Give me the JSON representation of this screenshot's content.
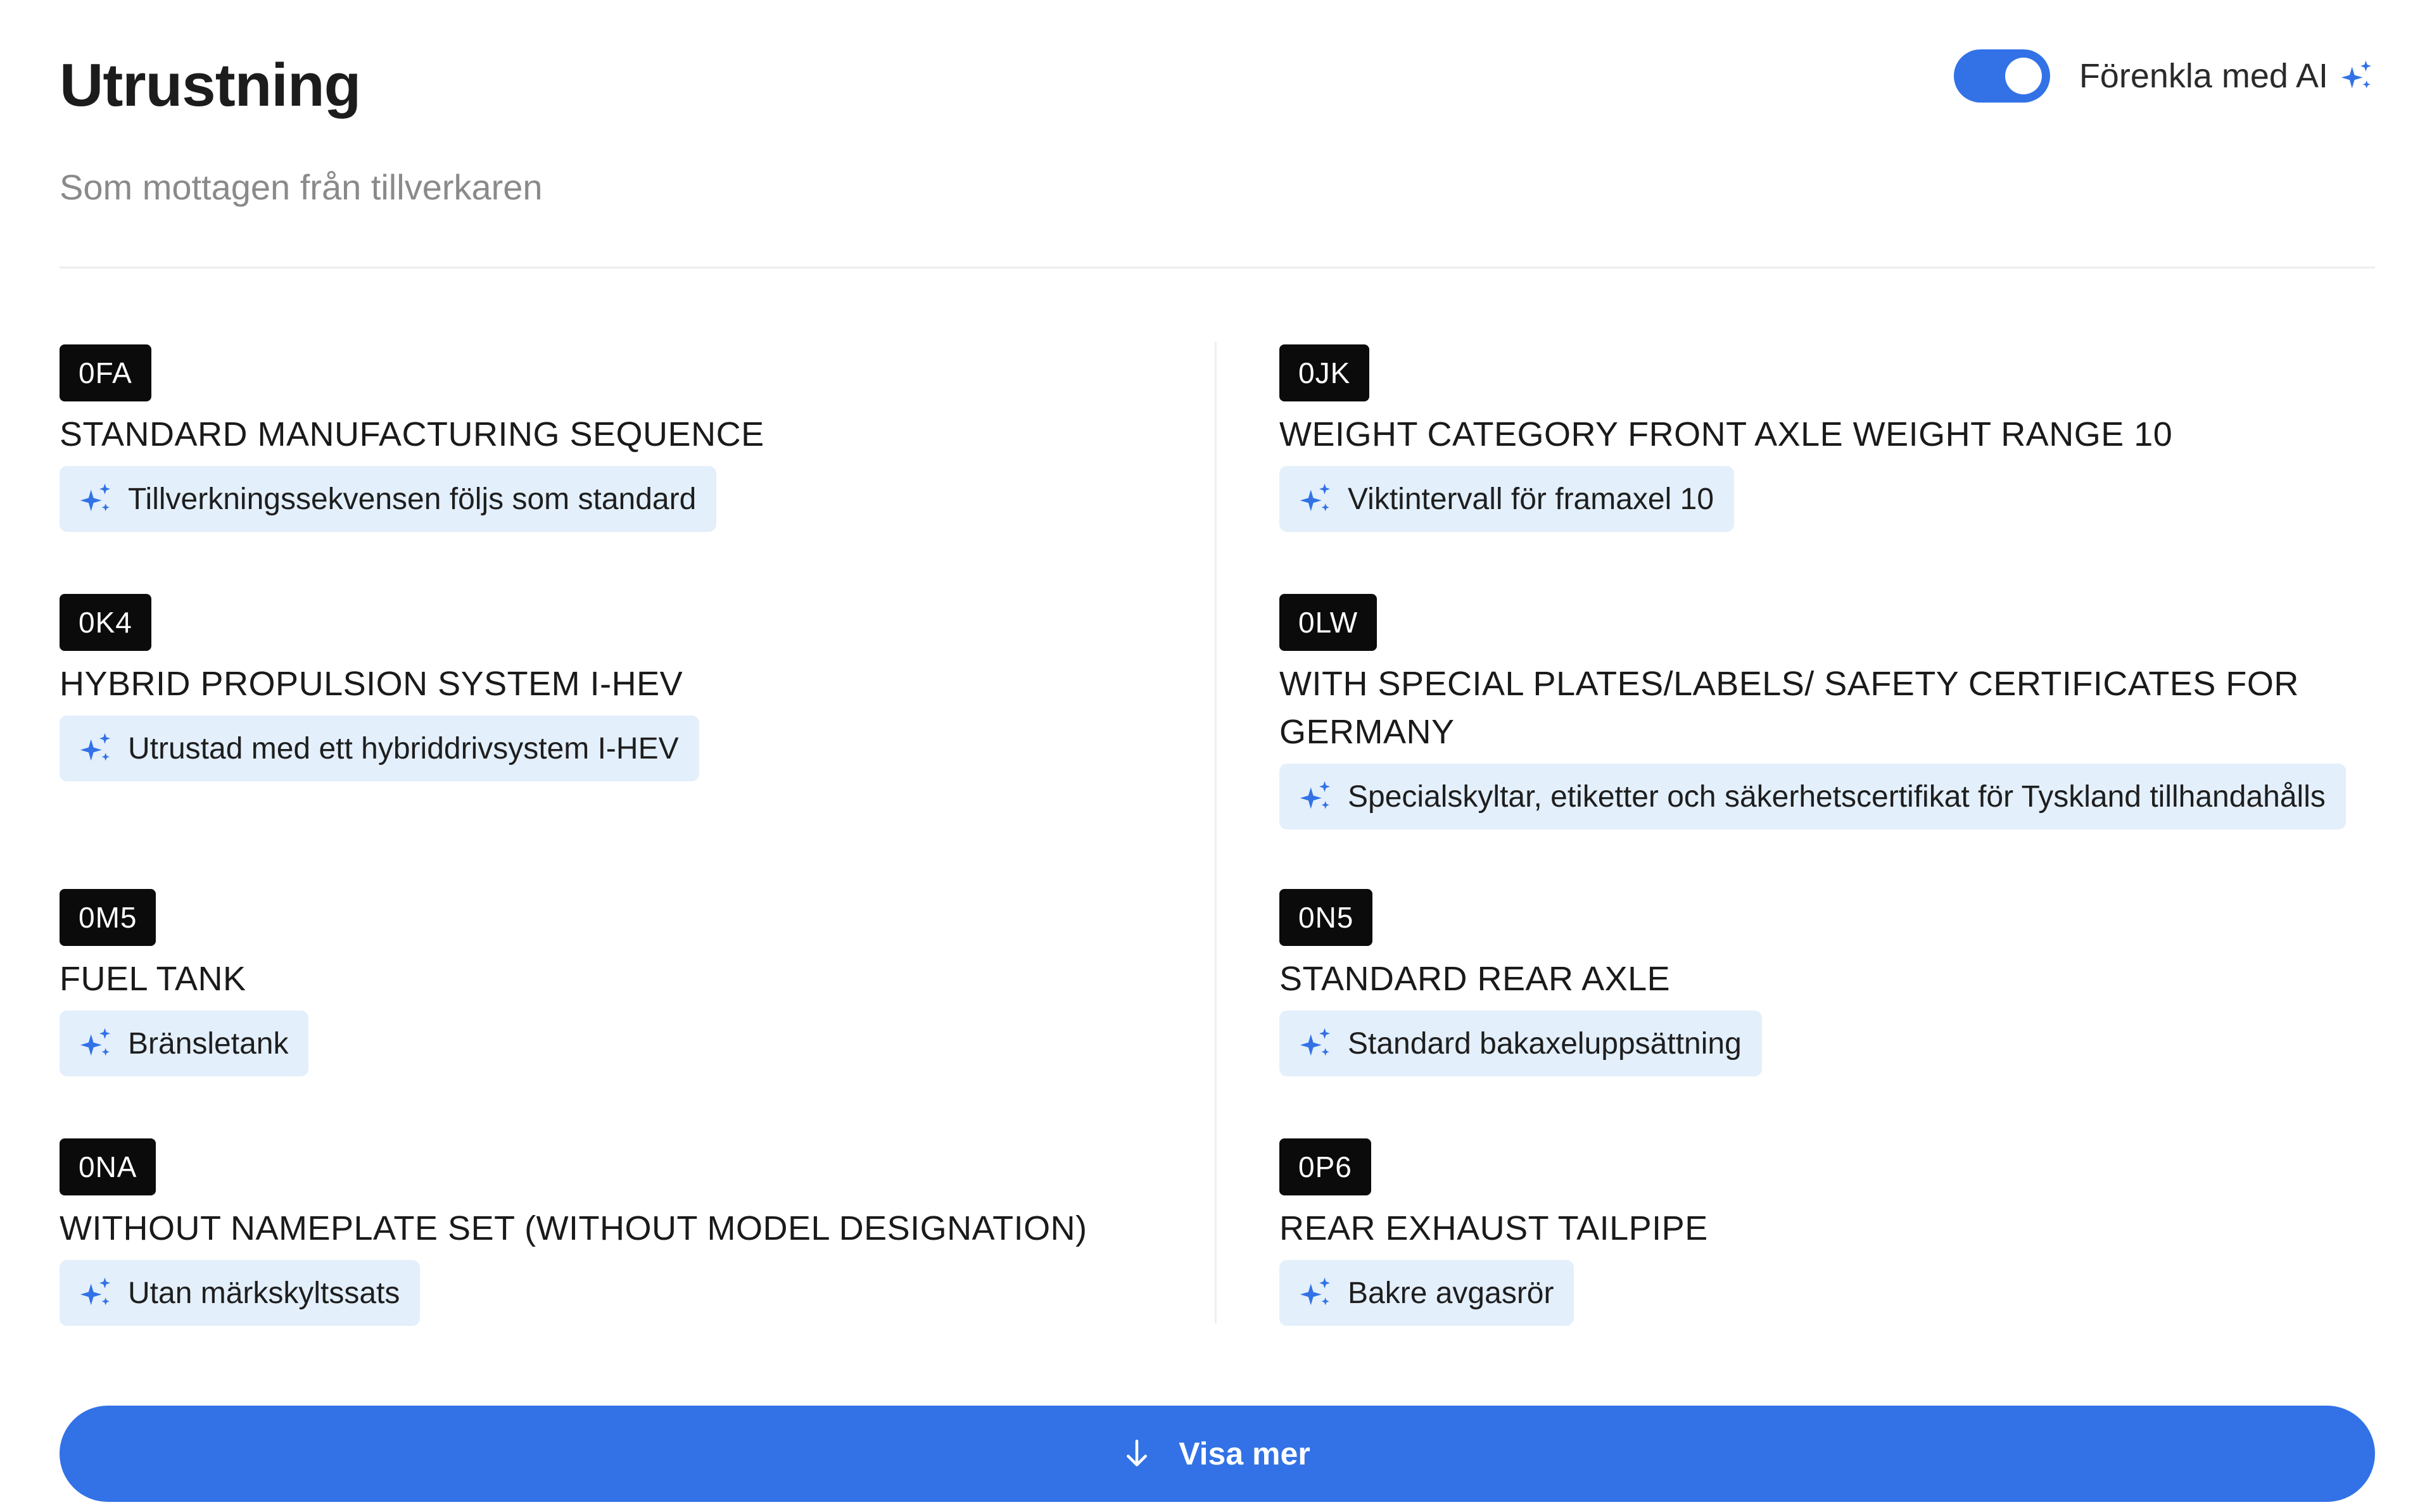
{
  "header": {
    "title": "Utrustning",
    "subtitle": "Som mottagen från tillverkaren",
    "ai_toggle_label": "Förenkla med AI",
    "ai_toggle_on": true
  },
  "items": [
    {
      "code": "0FA",
      "name": "STANDARD MANUFACTURING SEQUENCE",
      "ai_text": "Tillverkningssekvensen följs som standard"
    },
    {
      "code": "0JK",
      "name": "WEIGHT CATEGORY FRONT AXLE WEIGHT RANGE 10",
      "ai_text": "Viktintervall för framaxel 10"
    },
    {
      "code": "0K4",
      "name": "HYBRID PROPULSION SYSTEM I-HEV",
      "ai_text": "Utrustad med ett hybriddrivsystem I-HEV"
    },
    {
      "code": "0LW",
      "name": "WITH SPECIAL PLATES/LABELS/ SAFETY CERTIFICATES FOR GERMANY",
      "ai_text": "Specialskyltar, etiketter och säkerhetscertifikat för Tyskland tillhandahålls"
    },
    {
      "code": "0M5",
      "name": "FUEL TANK",
      "ai_text": "Bränsletank"
    },
    {
      "code": "0N5",
      "name": "STANDARD REAR AXLE",
      "ai_text": "Standard bakaxeluppsättning"
    },
    {
      "code": "0NA",
      "name": "WITHOUT NAMEPLATE SET (WITHOUT MODEL DESIGNATION)",
      "ai_text": "Utan märkskyltssats"
    },
    {
      "code": "0P6",
      "name": "REAR EXHAUST TAILPIPE",
      "ai_text": "Bakre avgasrör"
    }
  ],
  "show_more": {
    "label": "Visa mer",
    "icon": "arrow-down-icon"
  },
  "colors": {
    "accent": "#3272e6",
    "chip_bg": "#e3effb",
    "badge_bg": "#0b0b0b"
  }
}
